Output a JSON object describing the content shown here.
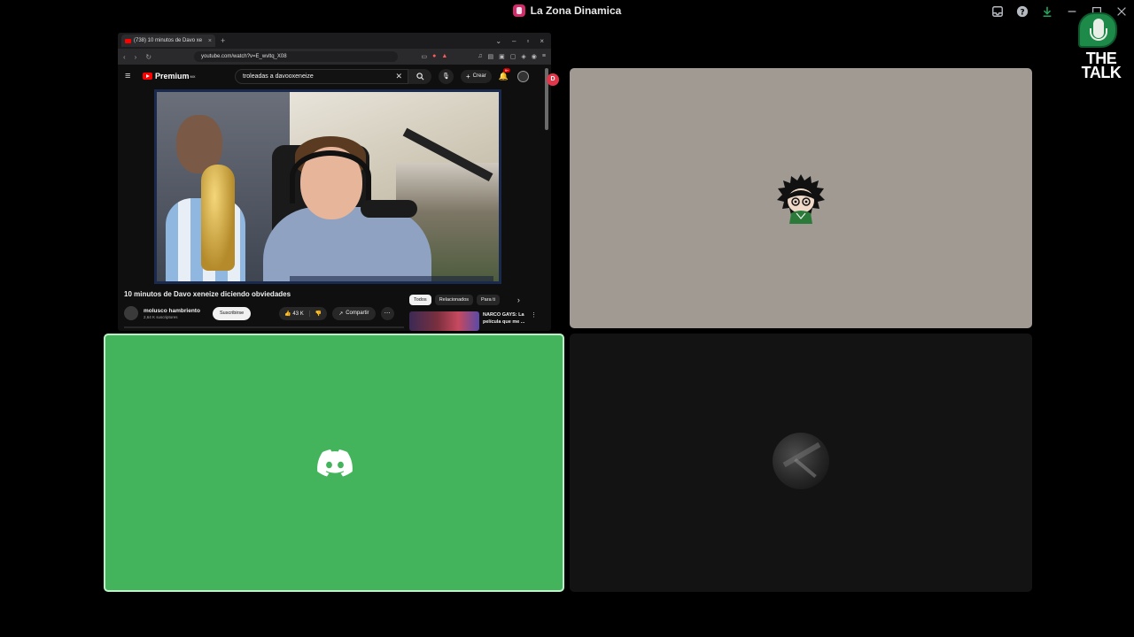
{
  "window": {
    "title": "La Zona Dinamica",
    "server_icon": "server-icon",
    "controls": [
      "inbox-icon",
      "help-icon",
      "download-icon",
      "minimize-icon",
      "maximize-icon",
      "close-icon"
    ]
  },
  "screen_share": {
    "browser": {
      "tab_title": "(738) 10 minutos de Davo xe",
      "new_tab": "+",
      "address": "youtube.com/watch?v=E_wvltq_X08"
    },
    "youtube": {
      "logo_text": "Premium",
      "logo_sup": "MX",
      "search_value": "troleadas a davooxeneize",
      "create_label": "Crear",
      "notif_count": "9+",
      "video_title": "10 minutos de Davo xeneize diciendo obviedades",
      "channel_name": "molusco hambriento",
      "channel_subs": "2,64 K suscriptores",
      "subscribe_label": "Suscribirse",
      "likes": "43 K",
      "share_label": "Compartir",
      "chips": [
        "Todos",
        "Relacionados",
        "Para ti"
      ],
      "rec_title": "NARCO GAYS: La película que me ..."
    },
    "side_badge": "D"
  },
  "logo": {
    "line1": "THE",
    "line2": "TALK"
  },
  "colors": {
    "speaking_tile": "#43b45c",
    "speaking_border": "#bdf3c8",
    "avatar_tile_bg": "#a09a93",
    "dark_tile_bg": "#131313",
    "youtube_red": "#ff0000"
  }
}
